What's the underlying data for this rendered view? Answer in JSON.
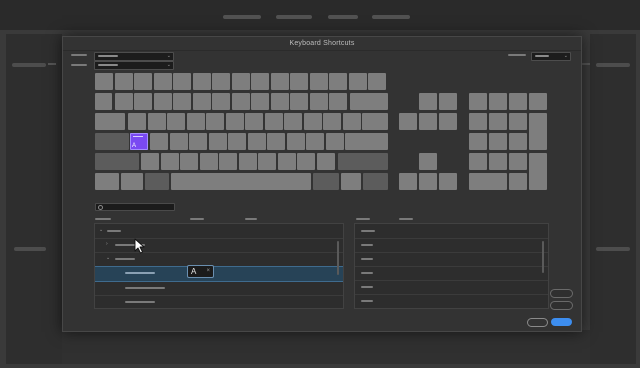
{
  "dialog": {
    "title": "Keyboard Shortcuts"
  },
  "keyboard": {
    "assigned_key_label": "A",
    "assigned_color": "#7a49f2"
  },
  "commands": {
    "selected_shortcut": "A",
    "shortcut_remove_glyph": "×",
    "expand_glyph": "›",
    "collapsed_glyph": "⌄"
  },
  "icons": {
    "dropdown_chevron": "⌄",
    "search": "magnifier",
    "pointer": "arrow-cursor"
  },
  "colors": {
    "accent": "#3d8ef0",
    "selection": "#274357",
    "key": "#7e7e7e"
  }
}
